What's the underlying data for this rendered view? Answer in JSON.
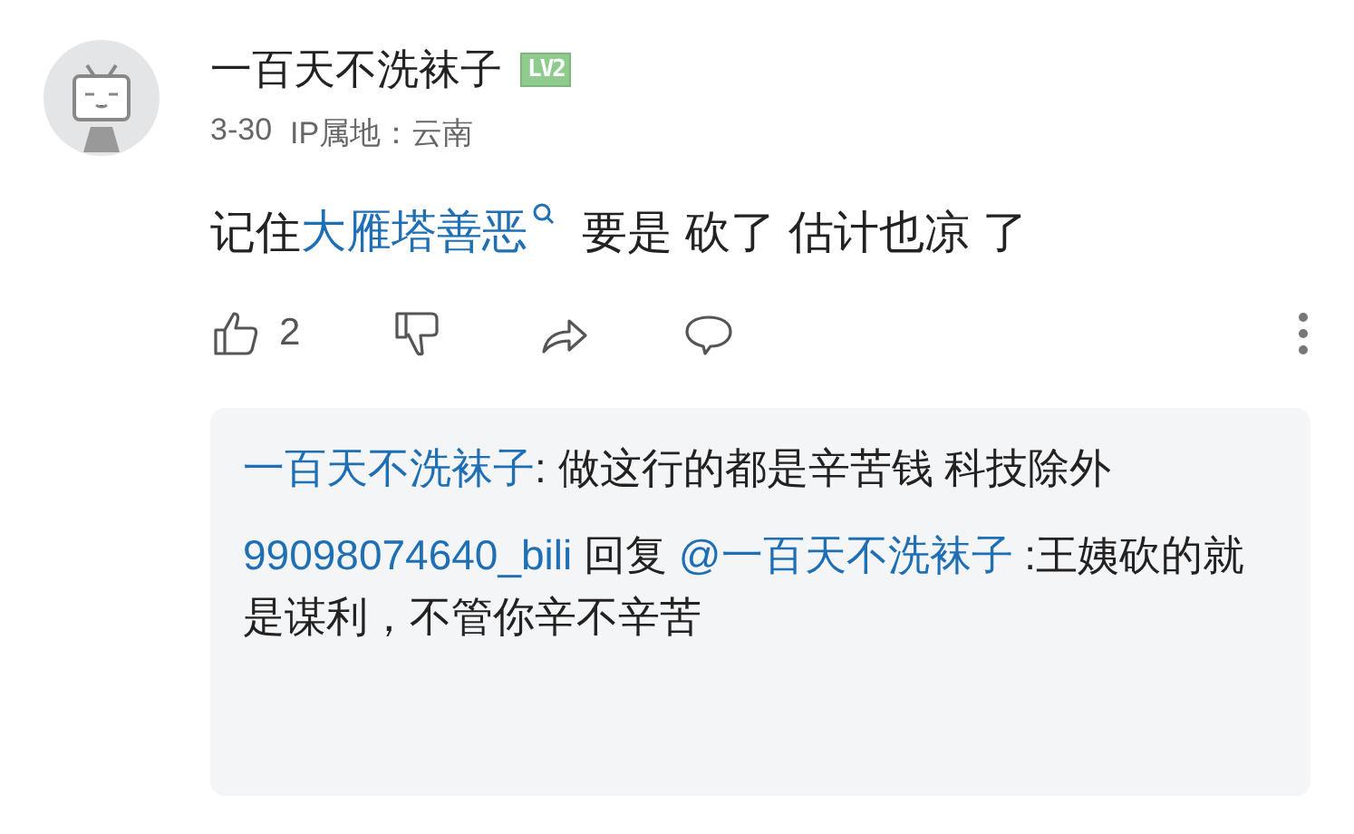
{
  "comment": {
    "user": "一百天不洗袜子",
    "level_badge": "LV2",
    "date": "3-30",
    "ip": "IP属地：云南",
    "content": [
      {
        "kind": "plain",
        "text": "记住"
      },
      {
        "kind": "link",
        "text": "大雁塔善恶"
      },
      {
        "kind": "plain",
        "text": "要是 砍了 估计也凉 了"
      }
    ],
    "likes": "2"
  },
  "replies": [
    {
      "parts": [
        {
          "kind": "user",
          "text": "一百天不洗袜子"
        },
        {
          "kind": "plain",
          "text": ": 做这行的都是辛苦钱 科技除外"
        }
      ]
    },
    {
      "parts": [
        {
          "kind": "user",
          "text": "99098074640_bili"
        },
        {
          "kind": "plain",
          "text": " 回复 "
        },
        {
          "kind": "user",
          "text": "@一百天不洗袜子"
        },
        {
          "kind": "plain",
          "text": " :王姨砍的就是谋利，不管你辛不辛苦"
        }
      ]
    }
  ]
}
